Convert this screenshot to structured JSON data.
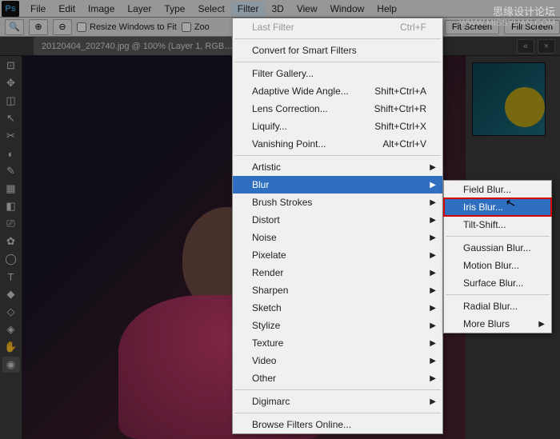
{
  "watermark": {
    "cn": "思缘设计论坛",
    "url": "WWW.MISSYUAN.COM"
  },
  "menubar": {
    "items": [
      "File",
      "Edit",
      "Image",
      "Layer",
      "Type",
      "Select",
      "Filter",
      "3D",
      "View",
      "Window",
      "Help"
    ],
    "active": "Filter"
  },
  "options": {
    "resize_windows": "Resize Windows to Fit",
    "zoom_all": "Zoo",
    "fit_screen": "Fit Screen",
    "fill_screen": "Fill Screen"
  },
  "doc": {
    "tab_title": "20120404_202740.jpg @ 100% (Layer 1, RGB…"
  },
  "tool_icons": [
    "▣",
    "⊡",
    "✥",
    "◫",
    "↖",
    "✂",
    "◐",
    "✎",
    "▦",
    "◧",
    "⎚",
    "✿",
    "◯",
    "T",
    "◆",
    "◇",
    "◈",
    "✋",
    "◉"
  ],
  "filter_menu": {
    "last_filter": "Last Filter",
    "last_filter_sc": "Ctrl+F",
    "convert_smart": "Convert for Smart Filters",
    "filter_gallery": "Filter Gallery...",
    "adaptive": "Adaptive Wide Angle...",
    "adaptive_sc": "Shift+Ctrl+A",
    "lens": "Lens Correction...",
    "lens_sc": "Shift+Ctrl+R",
    "liquify": "Liquify...",
    "liquify_sc": "Shift+Ctrl+X",
    "vanishing": "Vanishing Point...",
    "vanishing_sc": "Alt+Ctrl+V",
    "submenus": [
      "Artistic",
      "Blur",
      "Brush Strokes",
      "Distort",
      "Noise",
      "Pixelate",
      "Render",
      "Sharpen",
      "Sketch",
      "Stylize",
      "Texture",
      "Video",
      "Other"
    ],
    "digimarc": "Digimarc",
    "browse": "Browse Filters Online..."
  },
  "blur_menu": {
    "field": "Field Blur...",
    "iris": "Iris Blur...",
    "tilt": "Tilt-Shift...",
    "gaussian": "Gaussian Blur...",
    "motion": "Motion Blur...",
    "surface": "Surface Blur...",
    "radial": "Radial Blur...",
    "more": "More Blurs"
  }
}
